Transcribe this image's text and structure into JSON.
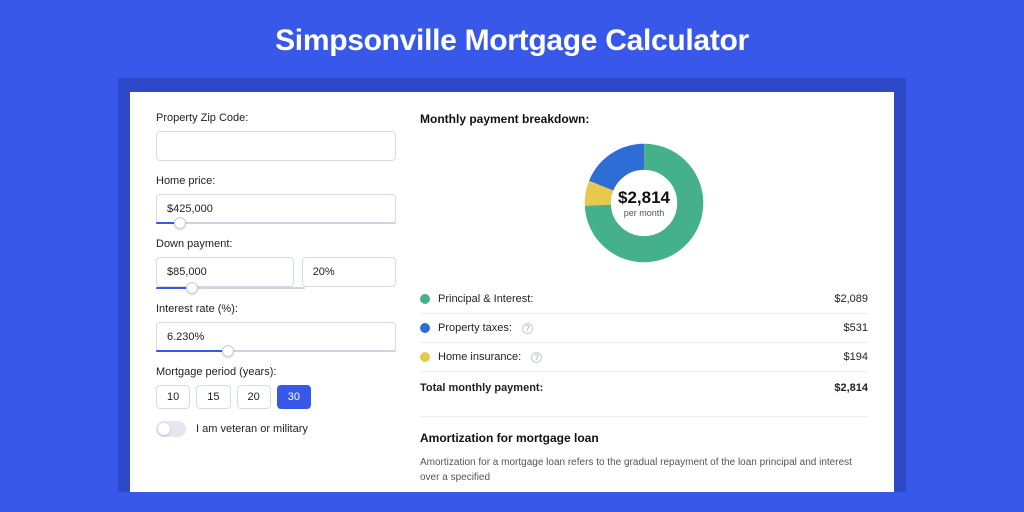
{
  "title": "Simpsonville Mortgage Calculator",
  "colors": {
    "accent": "#3858e9",
    "principal": "#45b08c",
    "taxes": "#2f6dd6",
    "insurance": "#e7c94f"
  },
  "left": {
    "zip_label": "Property Zip Code:",
    "zip_value": "",
    "home_price_label": "Home price:",
    "home_price_value": "$425,000",
    "home_price_slider_pct": 10,
    "down_payment_label": "Down payment:",
    "down_payment_value": "$85,000",
    "down_payment_pct": "20%",
    "down_payment_slider_pct": 24,
    "interest_label": "Interest rate (%):",
    "interest_value": "6.230%",
    "interest_slider_pct": 30,
    "period_label": "Mortgage period (years):",
    "period_options": [
      "10",
      "15",
      "20",
      "30"
    ],
    "period_selected": "30",
    "veteran_label": "I am veteran or military",
    "veteran_on": false
  },
  "right": {
    "breakdown_title": "Monthly payment breakdown:",
    "center_amount": "$2,814",
    "center_sub": "per month",
    "items": [
      {
        "name": "Principal & Interest:",
        "value": "$2,089",
        "color": "#45b08c",
        "has_help": false
      },
      {
        "name": "Property taxes:",
        "value": "$531",
        "color": "#2f6dd6",
        "has_help": true
      },
      {
        "name": "Home insurance:",
        "value": "$194",
        "color": "#e7c94f",
        "has_help": true
      }
    ],
    "total_label": "Total monthly payment:",
    "total_value": "$2,814",
    "amort_title": "Amortization for mortgage loan",
    "amort_text": "Amortization for a mortgage loan refers to the gradual repayment of the loan principal and interest over a specified"
  },
  "chart_data": {
    "type": "pie",
    "title": "Monthly payment breakdown",
    "series": [
      {
        "name": "Principal & Interest",
        "value": 2089,
        "color": "#45b08c"
      },
      {
        "name": "Property taxes",
        "value": 531,
        "color": "#2f6dd6"
      },
      {
        "name": "Home insurance",
        "value": 194,
        "color": "#e7c94f"
      }
    ],
    "total": 2814,
    "center_label": "$2,814 per month",
    "donut": true
  }
}
